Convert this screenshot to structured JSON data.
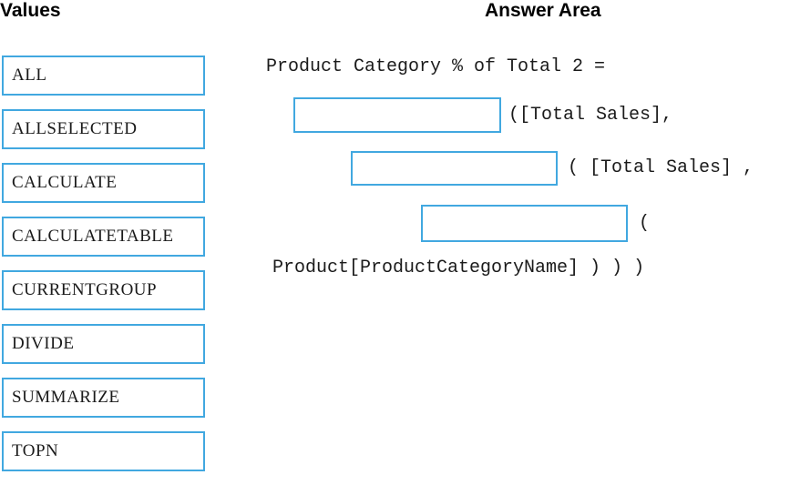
{
  "colors": {
    "box_border": "#41a8e0",
    "heading_text": "#010101",
    "body_text": "#1b1b1b",
    "background": "#ffffff"
  },
  "values_panel": {
    "heading": "Values",
    "items": [
      {
        "label": "ALL"
      },
      {
        "label": "ALLSELECTED"
      },
      {
        "label": "CALCULATE"
      },
      {
        "label": "CALCULATETABLE"
      },
      {
        "label": "CURRENTGROUP"
      },
      {
        "label": "DIVIDE"
      },
      {
        "label": "SUMMARIZE"
      },
      {
        "label": "TOPN"
      }
    ]
  },
  "answer_panel": {
    "heading": "Answer Area",
    "formula_lines": [
      {
        "id": "line-1",
        "has_box": false,
        "text": "Product Category % of Total 2 ="
      },
      {
        "id": "line-2",
        "has_box": true,
        "box_value": "",
        "box_placeholder": "",
        "text": "([Total Sales],"
      },
      {
        "id": "line-3",
        "has_box": true,
        "box_value": "",
        "box_placeholder": "",
        "text": "( [Total Sales] ,"
      },
      {
        "id": "line-4",
        "has_box": true,
        "box_value": "",
        "box_placeholder": "",
        "text": "("
      },
      {
        "id": "line-5",
        "has_box": false,
        "text": "Product[ProductCategoryName] ) ) )"
      }
    ]
  }
}
